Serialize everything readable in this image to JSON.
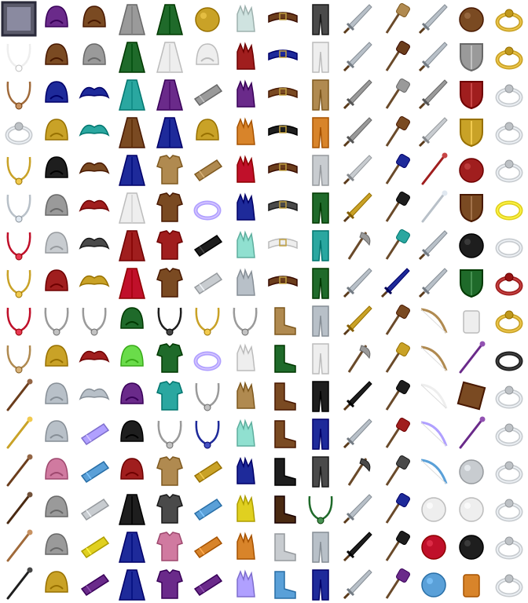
{
  "sheet": {
    "columns": 14,
    "rows": 16,
    "background": "#ffffff"
  },
  "palette": {
    "purple": "#6a2a8a",
    "brown": "#7a4a22",
    "grey": "#9a9a9a",
    "green": "#1f6a2a",
    "gold": "#c9a227",
    "pale": "#cfe3e0",
    "leather": "#6b3d1c",
    "darkgrey": "#4a4a4a",
    "steel": "#b8c0c8",
    "bronze": "#a06a3a",
    "blue": "#1e2a9a",
    "red": "#a01e1e",
    "teal": "#2aa7a0",
    "silver": "#c8ccd0",
    "tan": "#b08a50",
    "darkbrown": "#4a2a12",
    "black": "#1e1e1e",
    "lightblue": "#5aa0d8",
    "orange": "#d8842a",
    "pink": "#d07aa0",
    "yellow": "#e0d020",
    "lime": "#6adc4a",
    "white": "#eeeeee",
    "mint": "#90e0d0",
    "lavender": "#b0a0ff",
    "crimson": "#c0102a"
  },
  "columns": [
    {
      "category": "amulet",
      "icons": [
        "portrait-frame-icon",
        "bird-amulet-icon",
        "round-pendant-icon",
        "ring-pendant-icon",
        "gold-chain-icon",
        "dark-chain-icon",
        "ruby-chain-icon",
        "gold-necklace-icon",
        "medal-icon",
        "bead-necklace-icon",
        "wooden-staff-icon",
        "trident-staff-icon",
        "crook-staff-icon",
        "dark-staff-icon",
        "thin-staff-icon",
        "black-staff-icon"
      ],
      "colors": [
        "darkgrey",
        "white",
        "bronze",
        "silver",
        "gold",
        "steel",
        "crimson",
        "gold",
        "crimson",
        "tan",
        "leather",
        "gold",
        "leather",
        "darkbrown",
        "bronze",
        "black"
      ]
    },
    {
      "category": "helmet",
      "icons": [
        "purple-hood-icon",
        "leather-cap-icon",
        "blue-circlet-icon",
        "gold-crown-icon",
        "black-hood-icon",
        "wide-hat-icon",
        "cloth-cap-icon",
        "red-hood-icon",
        "chain-coif-icon",
        "gold-coif-icon",
        "steel-helm-icon",
        "visor-helm-icon",
        "plumed-helm-icon",
        "great-helm-icon",
        "crusader-helm-icon",
        "gold-helm-icon"
      ],
      "colors": [
        "purple",
        "brown",
        "blue",
        "gold",
        "black",
        "grey",
        "silver",
        "red",
        "grey",
        "gold",
        "steel",
        "steel",
        "pink",
        "grey",
        "grey",
        "gold"
      ]
    },
    {
      "category": "shoulders",
      "icons": [
        "brown-cape-icon",
        "grey-cape-icon",
        "blue-pauldrons-icon",
        "teal-pauldrons-icon",
        "brown-pauldrons-icon",
        "red-pauldrons-icon",
        "grey-pauldrons-icon",
        "gold-pauldrons-icon",
        "chain-pauldrons-icon",
        "red-mantle-icon",
        "plate-shoulder-icon",
        "lilac-bracer-icon",
        "blue-bracer-icon",
        "silver-bracer-icon",
        "yellow-bracer-icon",
        "violet-bracer-icon"
      ],
      "colors": [
        "brown",
        "grey",
        "blue",
        "teal",
        "brown",
        "red",
        "darkgrey",
        "gold",
        "grey",
        "red",
        "steel",
        "lavender",
        "lightblue",
        "silver",
        "yellow",
        "purple"
      ]
    },
    {
      "category": "cloak",
      "icons": [
        "grey-cloak-icon",
        "green-cloak-icon",
        "teal-cloak-icon",
        "brown-cloak-icon",
        "blue-cloak-icon",
        "white-cloak-icon",
        "red-cloak-icon",
        "crimson-cloak-icon",
        "green-cape-icon",
        "lime-cape-icon",
        "purple-cape-icon",
        "black-cape-icon",
        "red-cape-icon",
        "black-robe-icon",
        "blue-robe-icon",
        "blue-shroud-icon"
      ],
      "colors": [
        "grey",
        "green",
        "teal",
        "brown",
        "blue",
        "white",
        "red",
        "crimson",
        "green",
        "lime",
        "purple",
        "black",
        "red",
        "black",
        "blue",
        "blue"
      ]
    },
    {
      "category": "armor",
      "icons": [
        "green-robe-icon",
        "white-robe-icon",
        "purple-robe-icon",
        "blue-robe-icon",
        "tan-tunic-icon",
        "brown-tunic-icon",
        "red-tunic-icon",
        "leather-vest-icon",
        "chain-shirt-icon",
        "green-scale-icon",
        "teal-scale-icon",
        "chain-hauberk-icon",
        "tan-carapace-icon",
        "dark-carapace-icon",
        "pink-carapace-icon",
        "purple-carapace-icon"
      ],
      "colors": [
        "green",
        "white",
        "purple",
        "blue",
        "tan",
        "brown",
        "red",
        "brown",
        "black",
        "green",
        "teal",
        "grey",
        "tan",
        "darkgrey",
        "pink",
        "purple"
      ]
    },
    {
      "category": "bracers",
      "icons": [
        "gem-crown-icon",
        "pearl-circlet-icon",
        "steel-bracer-icon",
        "emerald-crown-icon",
        "wood-bracer-icon",
        "violet-ring-band-icon",
        "black-bracer-icon",
        "rune-bracer-icon",
        "gold-chain-coif-icon",
        "jewel-band-icon",
        "chain-hood-icon",
        "blue-chain-hood-icon",
        "horn-icon",
        "blue-horn-icon",
        "orange-horn-icon",
        "violet-horn-icon"
      ],
      "colors": [
        "gold",
        "white",
        "grey",
        "gold",
        "tan",
        "lavender",
        "black",
        "silver",
        "gold",
        "lavender",
        "grey",
        "blue",
        "gold",
        "lightblue",
        "orange",
        "purple"
      ]
    },
    {
      "category": "gloves",
      "icons": [
        "pale-gloves-icon",
        "red-gloves-icon",
        "purple-gloves-icon",
        "orange-gloves-icon",
        "crimson-gloves-icon",
        "blue-claws-icon",
        "mint-gauntlets-icon",
        "steel-gauntlets-icon",
        "chain-gauntlets-icon",
        "white-gauntlets-icon",
        "tan-gauntlets-icon",
        "mint-claws-icon",
        "blue-claws-icon",
        "yellow-claws-icon",
        "orange-claws-icon",
        "violet-claws-icon"
      ],
      "colors": [
        "pale",
        "red",
        "purple",
        "orange",
        "crimson",
        "blue",
        "mint",
        "steel",
        "grey",
        "white",
        "tan",
        "mint",
        "blue",
        "yellow",
        "orange",
        "lavender"
      ]
    },
    {
      "category": "belt",
      "icons": [
        "leather-strap-icon",
        "blue-belt-icon",
        "brown-belt-icon",
        "black-belt-icon",
        "leather-belt-icon",
        "dark-belt-icon",
        "white-belt-icon",
        "studded-belt-icon",
        "tan-boots-icon",
        "green-boots-icon",
        "brown-boots-icon",
        "leather-boots-icon",
        "black-boots-icon",
        "studded-boots-icon",
        "silver-boots-icon",
        "blue-boots-icon"
      ],
      "colors": [
        "leather",
        "blue",
        "brown",
        "black",
        "leather",
        "darkgrey",
        "white",
        "leather",
        "tan",
        "green",
        "brown",
        "brown",
        "black",
        "darkbrown",
        "silver",
        "lightblue"
      ]
    },
    {
      "category": "legs",
      "icons": [
        "grey-trousers-icon",
        "white-trousers-icon",
        "yellow-trousers-icon",
        "orange-greaves-icon",
        "silver-greaves-icon",
        "green-trousers-icon",
        "teal-trousers-icon",
        "green-greaves-icon",
        "steel-greaves-icon",
        "white-greaves-icon",
        "black-greaves-icon",
        "blue-greaves-icon",
        "spiked-greaves-icon",
        "green-chain-legs-icon",
        "plate-greaves-icon",
        "blue-plate-legs-icon"
      ],
      "colors": [
        "darkgrey",
        "white",
        "tan",
        "orange",
        "silver",
        "green",
        "teal",
        "green",
        "steel",
        "white",
        "black",
        "blue",
        "darkgrey",
        "green",
        "steel",
        "blue"
      ]
    },
    {
      "category": "blades",
      "icons": [
        "long-sword-icon",
        "scimitar-icon",
        "axe-blade-icon",
        "claw-blade-icon",
        "serrated-blade-icon",
        "gold-hilt-sword-icon",
        "battle-axe-icon",
        "thin-sword-icon",
        "gold-sword-icon",
        "double-axe-icon",
        "dark-sword-icon",
        "wave-sword-icon",
        "halberd-icon",
        "broad-sword-icon",
        "dark-blade-icon",
        "rapier-icon"
      ],
      "colors": [
        "steel",
        "steel",
        "grey",
        "grey",
        "silver",
        "gold",
        "grey",
        "steel",
        "gold",
        "grey",
        "black",
        "steel",
        "darkgrey",
        "steel",
        "black",
        "steel"
      ]
    },
    {
      "category": "maces",
      "icons": [
        "wooden-mace-icon",
        "wood-club-icon",
        "flail-icon",
        "club-icon",
        "blue-mace-icon",
        "morning-star-icon",
        "teal-mace-icon",
        "blue-sword-icon",
        "war-hammer-icon",
        "gold-hammer-icon",
        "black-hammer-icon",
        "red-hammer-icon",
        "stone-hammer-icon",
        "blue-hammer-icon",
        "dark-hammer-icon",
        "violet-hammer-icon"
      ],
      "colors": [
        "tan",
        "leather",
        "grey",
        "brown",
        "blue",
        "black",
        "teal",
        "blue",
        "brown",
        "gold",
        "black",
        "red",
        "darkgrey",
        "blue",
        "black",
        "purple"
      ]
    },
    {
      "category": "bows",
      "icons": [
        "dagger-icon",
        "short-sword-icon",
        "sickle-icon",
        "silver-knife-icon",
        "red-spear-icon",
        "spear-icon",
        "gladius-icon",
        "wide-sword-icon",
        "long-bow-icon",
        "recurve-bow-icon",
        "white-bow-icon",
        "violet-bow-icon",
        "blue-bow-icon",
        "crystal-gem-icon",
        "ruby-gem-icon",
        "sapphire-gem-icon"
      ],
      "colors": [
        "steel",
        "steel",
        "grey",
        "silver",
        "red",
        "steel",
        "steel",
        "steel",
        "tan",
        "tan",
        "white",
        "lavender",
        "lightblue",
        "white",
        "crimson",
        "lightblue"
      ]
    },
    {
      "category": "shields",
      "icons": [
        "bronze-orb-icon",
        "kite-shield-icon",
        "red-shield-icon",
        "round-shield-icon",
        "skull-shield-icon",
        "wood-shield-icon",
        "black-orb-icon",
        "green-shield-icon",
        "stein-icon",
        "gold-scepter-icon",
        "spellbook-icon",
        "violet-scepter-icon",
        "crystal-orb-icon",
        "skull-icon",
        "black-orb-icon",
        "idol-icon"
      ],
      "colors": [
        "brown",
        "grey",
        "red",
        "gold",
        "red",
        "brown",
        "black",
        "green",
        "white",
        "purple",
        "brown",
        "purple",
        "silver",
        "white",
        "black",
        "orange"
      ]
    },
    {
      "category": "rings",
      "icons": [
        "gold-ring-icon",
        "gold-gem-ring-icon",
        "silver-crown-ring-icon",
        "amethyst-ring-icon",
        "pearl-ring-icon",
        "gold-band-icon",
        "silver-band-icon",
        "red-ring-icon",
        "ruby-ring-icon",
        "black-band-icon",
        "garnet-ring-icon",
        "emerald-ring-icon",
        "sapphire-ring-icon",
        "onyx-ring-icon",
        "diamond-ring-icon",
        "crimson-ring-icon"
      ],
      "colors": [
        "gold",
        "gold",
        "silver",
        "silver",
        "silver",
        "yellow",
        "silver",
        "red",
        "gold",
        "black",
        "silver",
        "silver",
        "silver",
        "silver",
        "silver",
        "silver"
      ]
    }
  ]
}
